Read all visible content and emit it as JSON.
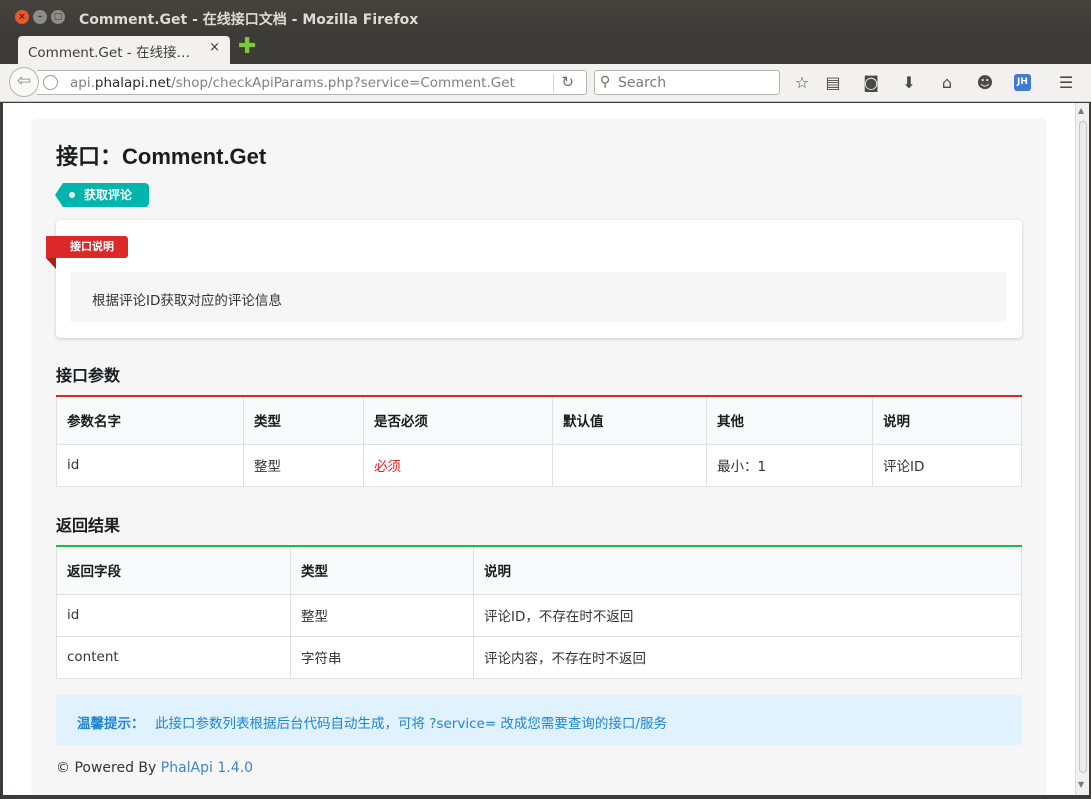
{
  "window": {
    "title": "Comment.Get - 在线接口文档 - Mozilla Firefox"
  },
  "tab": {
    "label": "Comment.Get - 在线接…",
    "close": "×",
    "new_tab": "✚"
  },
  "nav": {
    "url_host_prefix": "api.",
    "url_host": "phalapi.net",
    "url_path": "/shop/checkApiParams.php?service=Comment.Get",
    "search_placeholder": "Search",
    "jh_label": "JH"
  },
  "page": {
    "title": "接口：Comment.Get",
    "tag": "获取评论",
    "desc_ribbon": "接口说明",
    "description": "根据评论ID获取对应的评论信息",
    "params_heading": "接口参数",
    "params_headers": [
      "参数名字",
      "类型",
      "是否必须",
      "默认值",
      "其他",
      "说明"
    ],
    "params_rows": [
      {
        "name": "id",
        "type": "整型",
        "required": "必须",
        "default": "",
        "other": "最小：1",
        "desc": "评论ID"
      }
    ],
    "return_heading": "返回结果",
    "return_headers": [
      "返回字段",
      "类型",
      "说明"
    ],
    "return_rows": [
      {
        "field": "id",
        "type": "整型",
        "desc": "评论ID，不存在时不返回"
      },
      {
        "field": "content",
        "type": "字符串",
        "desc": "评论内容，不存在时不返回"
      }
    ],
    "tip_label": "温馨提示：",
    "tip_text": "此接口参数列表根据后台代码自动生成，可将 ?service= 改成您需要查询的接口/服务",
    "footer_prefix": "© Powered By",
    "footer_link": "PhalApi 1.4.0"
  },
  "colors": {
    "accent_teal": "#00b5ad",
    "accent_red": "#db2828",
    "accent_green": "#21ba45",
    "tip_blue": "#2185d0"
  }
}
